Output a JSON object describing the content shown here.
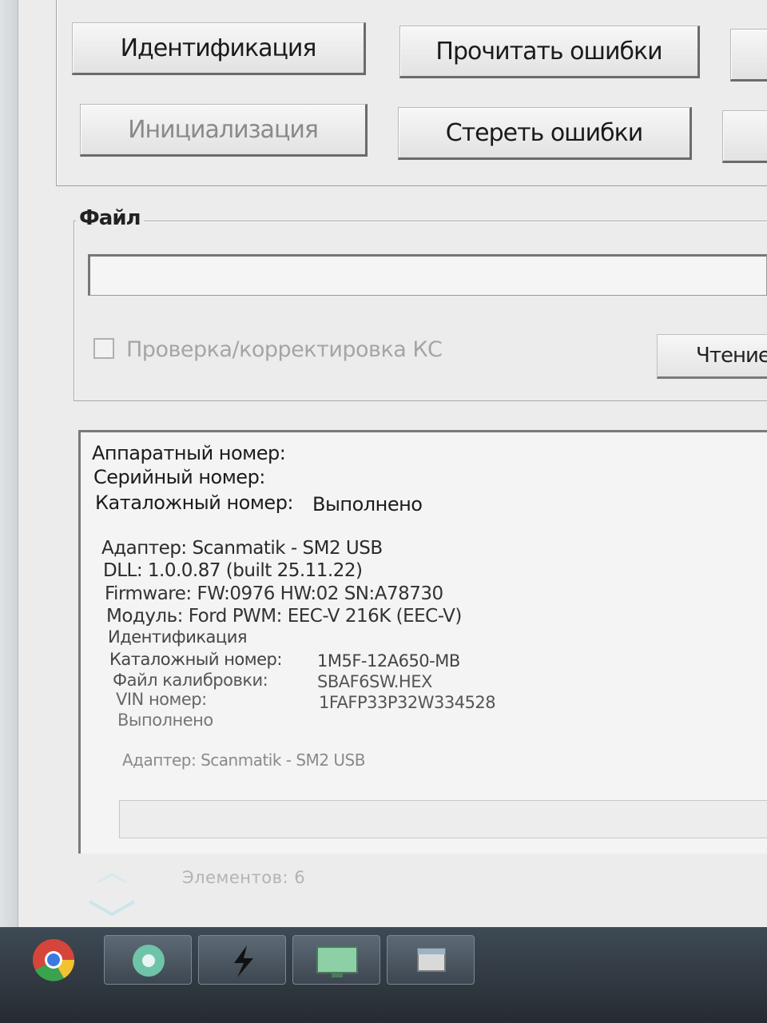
{
  "buttons": {
    "identification": "Идентификация",
    "read_errors": "Прочитать ошибки",
    "initialization": "Инициализация",
    "clear_errors": "Стереть ошибки"
  },
  "file_section": {
    "legend": "Файл",
    "path_value": "",
    "checksum_label": "Проверка/корректировка КС",
    "read_button": "Чтение"
  },
  "log": {
    "hw_number": "Аппаратный номер:",
    "serial_number": "Серийный номер:",
    "catalog_number_label": "Каталожный номер:",
    "catalog_number_status": "Выполнено",
    "adapter": "Адаптер: Scanmatik - SM2 USB",
    "dll": "DLL: 1.0.0.87 (built 25.11.22)",
    "firmware": "Firmware: FW:0976 HW:02 SN:A78730",
    "module": "Модуль: Ford PWM: EEC-V 216K (EEC-V)",
    "identification": "Идентификация",
    "id_catalog_label": "Каталожный номер:",
    "id_catalog_value": "1M5F-12A650-MB",
    "calibration_label": "Файл калибровки:",
    "calibration_value": "SBAF6SW.HEX",
    "vin_label": "VIN номер:",
    "vin_value": "1FAFP33P32W334528",
    "done": "Выполнено",
    "adapter_repeat": "Адаптер: Scanmatik - SM2 USB"
  },
  "status_bar": {
    "elements_count": "Элементов: 6"
  },
  "taskbar": {
    "apps": [
      "chrome-icon",
      "scanmatik-icon",
      "lightning-icon",
      "monitor-icon",
      "window-icon"
    ]
  },
  "colors": {
    "window_bg": "#ececec",
    "taskbar": "#2e353c",
    "disabled_text": "#a5a5a5"
  }
}
